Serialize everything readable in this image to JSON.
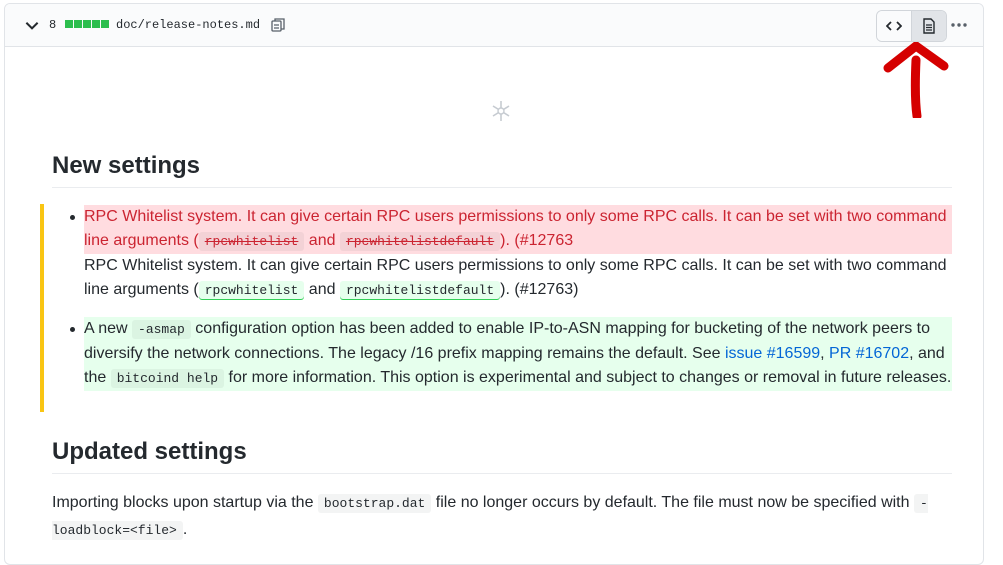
{
  "header": {
    "change_count": "8",
    "diffstat_colors": [
      "#2cbe4e",
      "#2cbe4e",
      "#2cbe4e",
      "#2cbe4e",
      "#2cbe4e"
    ],
    "file_path": "doc/release-notes.md"
  },
  "content": {
    "section1_title": "New settings",
    "item1": {
      "removed": {
        "text_a": "RPC Whitelist system. It can give certain RPC users permissions to only some RPC calls. It can be set with two command line arguments (",
        "code1": "rpcwhitelist",
        "and": " and ",
        "code2": "rpcwhitelistdefault",
        "text_b": "). (#12763"
      },
      "added": {
        "text_a": "RPC Whitelist system. It can give certain RPC users permissions to only some RPC calls. It can be set with two command line arguments (",
        "code1": "rpcwhitelist",
        "and": " and ",
        "code2": "rpcwhitelistdefault",
        "text_b": "). (#12763)"
      }
    },
    "item2": {
      "text_a": "A new ",
      "code1": "-asmap",
      "text_b": " configuration option has been added to enable IP-to-ASN mapping for bucketing of the network peers to diversify the network connections. The legacy /16 prefix mapping remains the default. See ",
      "link1": "issue #16599",
      "comma": ", ",
      "link2": "PR #16702",
      "text_c": ", and the ",
      "code2": "bitcoind help",
      "text_d": " for more information. This option is experimental and subject to changes or removal in future releases."
    },
    "section2_title": "Updated settings",
    "para": {
      "text_a": "Importing blocks upon startup via the ",
      "code1": "bootstrap.dat",
      "text_b": " file no longer occurs by default. The file must now be specified with ",
      "code2": "-loadblock=<file>",
      "text_c": "."
    }
  },
  "colors": {
    "annotation_arrow": "#d50000",
    "changed_bar": "#f9c513",
    "link": "#0366d6"
  }
}
